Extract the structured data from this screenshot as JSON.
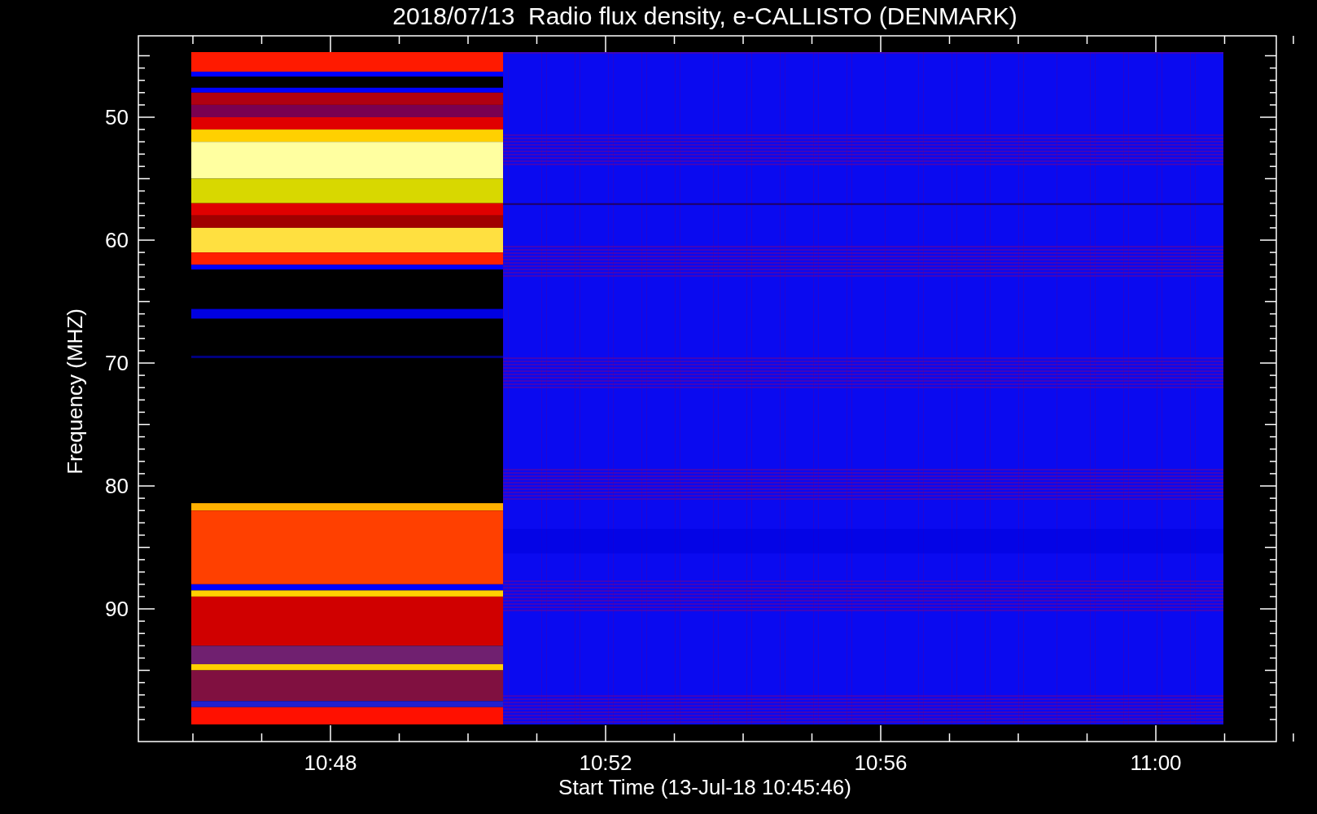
{
  "title": "2018/07/13  Radio flux density, e-CALLISTO (DENMARK)",
  "y_axis": {
    "label": "Frequency (MHZ)",
    "ticks": [
      "50",
      "60",
      "70",
      "80",
      "90"
    ]
  },
  "x_axis": {
    "label": "Start Time (13-Jul-18 10:45:46)",
    "ticks": [
      "10:48",
      "10:52",
      "10:56",
      "11:00"
    ]
  }
}
